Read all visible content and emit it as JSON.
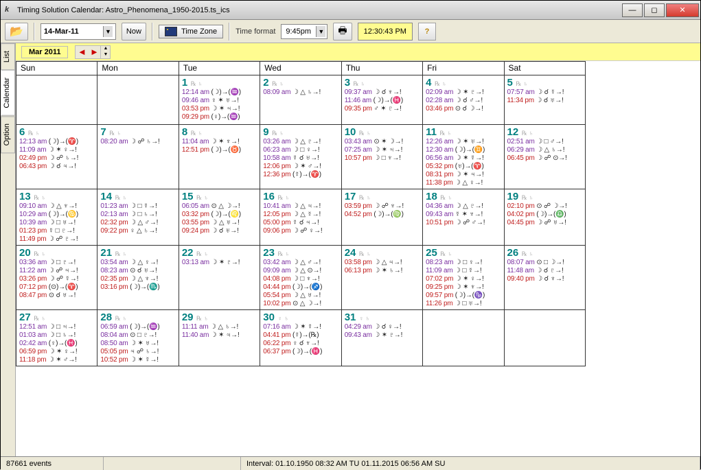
{
  "window": {
    "title": "Timing Solution Calendar: Astro_Phenomena_1950-2015.ts_ics"
  },
  "toolbar": {
    "current_date": "14-Mar-11",
    "now_label": "Now",
    "timezone_label": "Time Zone",
    "time_format_label": "Time format",
    "time_format_value": "9:45pm",
    "clock_value": "12:30:43 PM",
    "help_label": "?"
  },
  "tabs": {
    "list": "List",
    "calendar": "Calendar",
    "option": "Option"
  },
  "header": {
    "month_label": "Mar  2011",
    "days": [
      "Sun",
      "Mon",
      "Tue",
      "Wed",
      "Thu",
      "Fri",
      "Sat"
    ]
  },
  "badge_text": "℞ ♄",
  "grid": [
    [
      {
        "n": "",
        "ev": []
      },
      {
        "n": "",
        "ev": []
      },
      {
        "n": "1",
        "ev": [
          [
            "12:14 am",
            "(☽)→(♒)"
          ],
          [
            "09:46 am",
            "♀ ✶ ♅→!"
          ],
          [
            "03:53 pm",
            "☽ ✶ ♃→!"
          ],
          [
            "09:29 pm",
            "(♀)→(♒)"
          ]
        ]
      },
      {
        "n": "2",
        "ev": [
          [
            "08:09 am",
            "☽ △ ♄→!"
          ]
        ]
      },
      {
        "n": "3",
        "ev": [
          [
            "09:37 am",
            "☽ ☌ ♆→!"
          ],
          [
            "11:46 am",
            "(☽)→(♓)"
          ],
          [
            "09:35 pm",
            "♂ ✶ ♇→!"
          ]
        ]
      },
      {
        "n": "4",
        "ev": [
          [
            "02:09 am",
            "☽ ✶ ♇→!"
          ],
          [
            "02:28 am",
            "☽ ☌ ♂→!"
          ],
          [
            "03:46 pm",
            "⊙ ☌ ☽→!"
          ]
        ]
      },
      {
        "n": "5",
        "ev": [
          [
            "07:57 am",
            "☽ ☌ ☿→!"
          ],
          [
            "11:34 pm",
            "☽ ☌ ♅→!"
          ]
        ]
      }
    ],
    [
      {
        "n": "6",
        "ev": [
          [
            "12:13 am",
            "(☽)→(♈)"
          ],
          [
            "11:09 am",
            "☽ ✶ ♀→!"
          ],
          [
            "02:49 pm",
            "☽ ☍ ♄→!"
          ],
          [
            "06:43 pm",
            "☽ ☌ ♃→!"
          ]
        ]
      },
      {
        "n": "7",
        "ev": [
          [
            "08:20 am",
            "☽ ☍ ♄→!"
          ]
        ]
      },
      {
        "n": "8",
        "ev": [
          [
            "11:04 am",
            "☽ ✶ ♆→!"
          ],
          [
            "12:51 pm",
            "(☽)→(♉)"
          ]
        ]
      },
      {
        "n": "9",
        "ev": [
          [
            "03:26 am",
            "☽ △ ♇→!"
          ],
          [
            "06:23 am",
            "☽ □ ♀→!"
          ],
          [
            "10:58 am",
            "☿ ☌ ♅→!"
          ],
          [
            "12:06 pm",
            "☽ ✶ ♂→!"
          ],
          [
            "12:36 pm",
            "(☿)→(♈)"
          ]
        ]
      },
      {
        "n": "10",
        "ev": [
          [
            "03:43 am",
            "⊙ ✶ ☽→!"
          ],
          [
            "07:25 am",
            "☽ ✶ ♃→!"
          ],
          [
            "10:57 pm",
            "☽ □ ♆→!"
          ]
        ]
      },
      {
        "n": "11",
        "ev": [
          [
            "12:26 am",
            "☽ ✶ ♅→!"
          ],
          [
            "12:30 am",
            "(☽)→(♊)"
          ],
          [
            "06:56 am",
            "☽ ✶ ☿→!"
          ],
          [
            "05:32 pm",
            "(♅)→(♈)"
          ],
          [
            "08:31 pm",
            "☽ ✶ ♃→!"
          ],
          [
            "11:38 pm",
            "☽ △ ♀→!"
          ]
        ]
      },
      {
        "n": "12",
        "ev": [
          [
            "02:51 am",
            "☽ □ ♂→!"
          ],
          [
            "06:29 am",
            "☽ △ ♄→!"
          ],
          [
            "06:45 pm",
            "☽ ☍ ⊙→!"
          ]
        ]
      }
    ],
    [
      {
        "n": "13",
        "ev": [
          [
            "09:10 am",
            "☽ △ ♆→!"
          ],
          [
            "10:29 am",
            "(☽)→(♋)"
          ],
          [
            "10:39 am",
            "☽ □ ♅→!"
          ],
          [
            "01:23 pm",
            "☿ □ ♇→!"
          ],
          [
            "11:49 pm",
            "☽ ☍ ♇→!"
          ]
        ]
      },
      {
        "n": "14",
        "ev": [
          [
            "01:23 am",
            "☽ □ ☿→!"
          ],
          [
            "02:13 am",
            "☽ □ ♄→!"
          ],
          [
            "02:32 pm",
            "☽ △ ♂→!"
          ],
          [
            "09:22 pm",
            "♀ △ ♄→!"
          ]
        ]
      },
      {
        "n": "15",
        "ev": [
          [
            "06:05 am",
            "⊙ △ ☽→!"
          ],
          [
            "03:32 pm",
            "(☽)→(♌)"
          ],
          [
            "03:55 pm",
            "☽ △ ♅→!"
          ],
          [
            "09:24 pm",
            "☽ ☌ ♅→!"
          ]
        ]
      },
      {
        "n": "16",
        "ev": [
          [
            "10:41 am",
            "☽ △ ♃→!"
          ],
          [
            "12:05 pm",
            "☽ △ ☿→!"
          ],
          [
            "05:00 pm",
            "☿ ☌ ♃→!"
          ],
          [
            "09:06 pm",
            "☽ ☍ ♀→!"
          ]
        ]
      },
      {
        "n": "17",
        "ev": [
          [
            "03:59 pm",
            "☽ ☍ ♆→!"
          ],
          [
            "04:52 pm",
            "(☽)→(♍)"
          ]
        ]
      },
      {
        "n": "18",
        "ev": [
          [
            "04:36 am",
            "☽ △ ♇→!"
          ],
          [
            "09:43 am",
            "☿ ✶ ♆→!"
          ],
          [
            "10:51 pm",
            "☽ ☍ ♂→!"
          ]
        ]
      },
      {
        "n": "19",
        "ev": [
          [
            "02:10 pm",
            "⊙ ☍ ☽→!"
          ],
          [
            "04:02 pm",
            "(☽)→(♎)"
          ],
          [
            "04:45 pm",
            "☽ ☍ ♅→!"
          ]
        ]
      }
    ],
    [
      {
        "n": "20",
        "ev": [
          [
            "03:36 am",
            "☽ □ ♇→!"
          ],
          [
            "11:22 am",
            "☽ ☍ ♃→!"
          ],
          [
            "03:26 pm",
            "☽ ☍ ☿→!"
          ],
          [
            "07:12 pm",
            "(⊙)→(♈)"
          ],
          [
            "08:47 pm",
            "⊙ ☌ ♅→!"
          ]
        ]
      },
      {
        "n": "21",
        "ev": [
          [
            "03:54 am",
            "☽ △ ♀→!"
          ],
          [
            "08:23 am",
            "⊙ ☌ ♅→!"
          ],
          [
            "02:35 pm",
            "☽ △ ♆→!"
          ],
          [
            "03:16 pm",
            "(☽)→(♏)"
          ]
        ]
      },
      {
        "n": "22",
        "ev": [
          [
            "03:13 am",
            "☽ ✶ ♇→!"
          ]
        ]
      },
      {
        "n": "23",
        "ev": [
          [
            "03:42 am",
            "☽ △ ♂→!"
          ],
          [
            "09:09 am",
            "☽ △ ⊙→!"
          ],
          [
            "04:08 pm",
            "☽ □ ♆→!"
          ],
          [
            "04:44 pm",
            "(☽)→(♐)"
          ],
          [
            "05:54 pm",
            "☽ △ ♅→!"
          ],
          [
            "10:02 pm",
            "⊙ △ ☽→!"
          ]
        ]
      },
      {
        "n": "24",
        "ev": [
          [
            "03:58 pm",
            "☽ △ ♃→!"
          ],
          [
            "06:13 pm",
            "☽ ✶ ♄→!"
          ]
        ]
      },
      {
        "n": "25",
        "ev": [
          [
            "08:23 am",
            "☽ □ ♀→!"
          ],
          [
            "11:09 am",
            "☽ □ ☿→!"
          ],
          [
            "07:02 pm",
            "☽ ✶ ♀→!"
          ],
          [
            "09:25 pm",
            "☽ ✶ ♆→!"
          ],
          [
            "09:57 pm",
            "(☽)→(♑)"
          ],
          [
            "11:26 pm",
            "☽ □ ♅→!"
          ]
        ]
      },
      {
        "n": "26",
        "ev": [
          [
            "08:07 am",
            "⊙ □ ☽→!"
          ],
          [
            "11:48 am",
            "☽ ☌ ♇→!"
          ],
          [
            "09:40 pm",
            "☽ ☌ ♆→!"
          ]
        ]
      }
    ],
    [
      {
        "n": "27",
        "ev": [
          [
            "12:51 am",
            "☽ □ ♃→!"
          ],
          [
            "01:03 am",
            "☽ □ ♄→!"
          ],
          [
            "02:42 am",
            "(♀)→(♓)"
          ],
          [
            "06:59 pm",
            "☽ ✶ ♀→!"
          ],
          [
            "11:18 pm",
            "☽ ✶ ♂→!"
          ]
        ]
      },
      {
        "n": "28",
        "ev": [
          [
            "06:59 am",
            "(☽)→(♒)"
          ],
          [
            "08:04 am",
            "⊙ □ ♇→!"
          ],
          [
            "08:50 am",
            "☽ ✶ ♅→!"
          ],
          [
            "05:05 pm",
            "♃ ☍ ♄→!"
          ],
          [
            "10:52 pm",
            "☽ ✶ ☿→!"
          ]
        ]
      },
      {
        "n": "29",
        "ev": [
          [
            "11:11 am",
            "☽ △ ♄→!"
          ],
          [
            "11:40 am",
            "☽ ✶ ♃→!"
          ]
        ]
      },
      {
        "n": "30",
        "badge": "♀ ♄",
        "ev": [
          [
            "07:16 am",
            "☽ ✶ ☿→!"
          ],
          [
            "04:41 pm",
            "(☿)→(℞)"
          ],
          [
            "06:22 pm",
            "♀ ☌ ♆→!"
          ],
          [
            "06:37 pm",
            "(☽)→(♓)"
          ]
        ]
      },
      {
        "n": "31",
        "badge": "♀ ♄",
        "ev": [
          [
            "04:29 am",
            "☽ ☌ ♀→!"
          ],
          [
            "09:43 am",
            "☽ ✶ ♇→!"
          ]
        ]
      },
      {
        "n": "",
        "ev": []
      },
      {
        "n": "",
        "ev": []
      }
    ]
  ],
  "status": {
    "events": "87661 events",
    "interval": "Interval: 01.10.1950  08:32 AM TU   01.11.2015  06:56 AM SU"
  }
}
